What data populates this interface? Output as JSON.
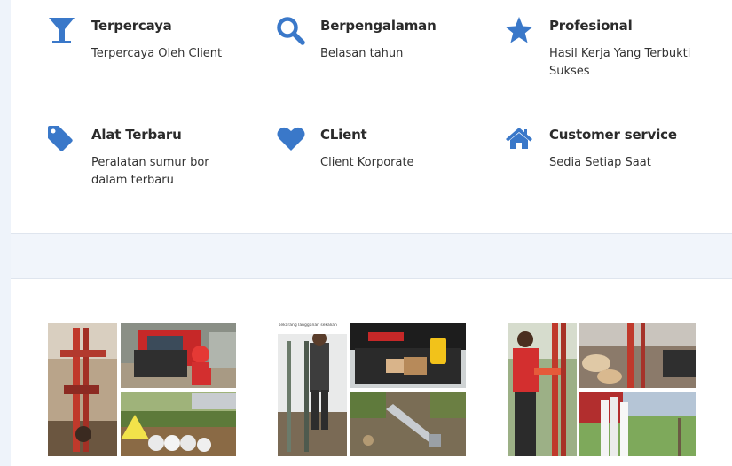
{
  "features": [
    {
      "title": "Terpercaya",
      "desc": "Terpercaya Oleh Client",
      "icon": "cocktail-glass-icon"
    },
    {
      "title": "Berpengalaman",
      "desc": "Belasan tahun",
      "icon": "search-icon"
    },
    {
      "title": "Profesional",
      "desc": "Hasil Kerja Yang Terbukti Sukses",
      "icon": "star-icon"
    },
    {
      "title": "Alat Terbaru",
      "desc": "Peralatan sumur bor dalam terbaru",
      "icon": "tag-icon"
    },
    {
      "title": "CLient",
      "desc": "Client Korporate",
      "icon": "heart-icon"
    },
    {
      "title": "Customer service",
      "desc": "Sedia Setiap Saat",
      "icon": "home-icon"
    }
  ],
  "colors": {
    "accent": "#3a78c9",
    "text": "#333333",
    "background": "#eef3fa"
  },
  "gallery": {
    "photo2_caption": "sekarang langganan sekalian"
  }
}
